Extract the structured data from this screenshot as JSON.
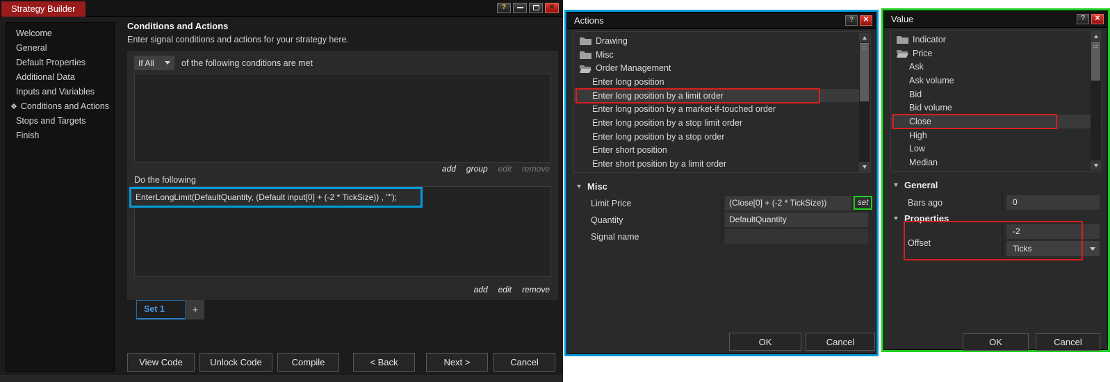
{
  "colors": {
    "annotation_red": "#d81f1f",
    "annotation_cyan": "#019cdc",
    "annotation_green": "#1fd11f",
    "titlebar_red": "#9a1b1b",
    "accent_blue": "#4795e0",
    "window_bg": "#1c1c1c",
    "panel_bg": "#2a2a2a"
  },
  "icons": {
    "help": "?",
    "close": "✕",
    "plus": "+",
    "selected_marker": "❖"
  },
  "strategy_builder": {
    "title": "Strategy Builder",
    "sidebar": {
      "items": [
        {
          "label": "Welcome"
        },
        {
          "label": "General"
        },
        {
          "label": "Default Properties"
        },
        {
          "label": "Additional Data"
        },
        {
          "label": "Inputs and Variables"
        },
        {
          "label": "Conditions and Actions",
          "selected": true
        },
        {
          "label": "Stops and Targets"
        },
        {
          "label": "Finish"
        }
      ]
    },
    "content": {
      "heading": "Conditions and Actions",
      "subheading": "Enter signal conditions and actions for your strategy here.",
      "condition_mode": "If All",
      "condition_suffix": "of the following conditions are met",
      "conditions_links": [
        {
          "label": "add",
          "enabled": true
        },
        {
          "label": "group",
          "enabled": true
        },
        {
          "label": "edit",
          "enabled": false
        },
        {
          "label": "remove",
          "enabled": false
        }
      ],
      "do_following_label": "Do the following",
      "action_code": "EnterLongLimit(DefaultQuantity, (Default input[0] + (-2 * TickSize)) , \"\");",
      "actions_links": [
        {
          "label": "add",
          "enabled": true
        },
        {
          "label": "edit",
          "enabled": true
        },
        {
          "label": "remove",
          "enabled": true
        }
      ],
      "set_tab_label": "Set 1",
      "add_set_label": "+",
      "footer_buttons": [
        "View Code",
        "Unlock Code",
        "Compile",
        "< Back",
        "Next >",
        "Cancel"
      ]
    }
  },
  "actions_dialog": {
    "title": "Actions",
    "tree": [
      {
        "label": "Drawing",
        "type": "folder"
      },
      {
        "label": "Misc",
        "type": "folder"
      },
      {
        "label": "Order Management",
        "type": "folder-open"
      },
      {
        "label": "Enter long position",
        "type": "item"
      },
      {
        "label": "Enter long position by a limit order",
        "type": "item",
        "selected": true,
        "annotated": true
      },
      {
        "label": "Enter long position by a market-if-touched order",
        "type": "item"
      },
      {
        "label": "Enter long position by a stop limit order",
        "type": "item"
      },
      {
        "label": "Enter long position by a stop order",
        "type": "item"
      },
      {
        "label": "Enter short position",
        "type": "item"
      },
      {
        "label": "Enter short position by a limit order",
        "type": "item"
      }
    ],
    "properties": {
      "group_label": "Misc",
      "limit_price_label": "Limit Price",
      "limit_price_value": "(Close[0] + (-2 * TickSize))",
      "set_button_label": "set",
      "quantity_label": "Quantity",
      "quantity_value": "DefaultQuantity",
      "signal_name_label": "Signal name",
      "signal_name_value": ""
    },
    "ok_label": "OK",
    "cancel_label": "Cancel"
  },
  "value_dialog": {
    "title": "Value",
    "tree": [
      {
        "label": "Indicator",
        "type": "folder"
      },
      {
        "label": "Price",
        "type": "folder-open"
      },
      {
        "label": "Ask",
        "type": "item"
      },
      {
        "label": "Ask volume",
        "type": "item"
      },
      {
        "label": "Bid",
        "type": "item"
      },
      {
        "label": "Bid volume",
        "type": "item"
      },
      {
        "label": "Close",
        "type": "item",
        "selected": true,
        "annotated": true
      },
      {
        "label": "High",
        "type": "item"
      },
      {
        "label": "Low",
        "type": "item"
      },
      {
        "label": "Median",
        "type": "item"
      }
    ],
    "general_group_label": "General",
    "bars_ago_label": "Bars ago",
    "bars_ago_value": "0",
    "properties_group_label": "Properties",
    "offset_label": "Offset",
    "offset_value": "-2",
    "offset_unit": "Ticks",
    "ok_label": "OK",
    "cancel_label": "Cancel"
  }
}
